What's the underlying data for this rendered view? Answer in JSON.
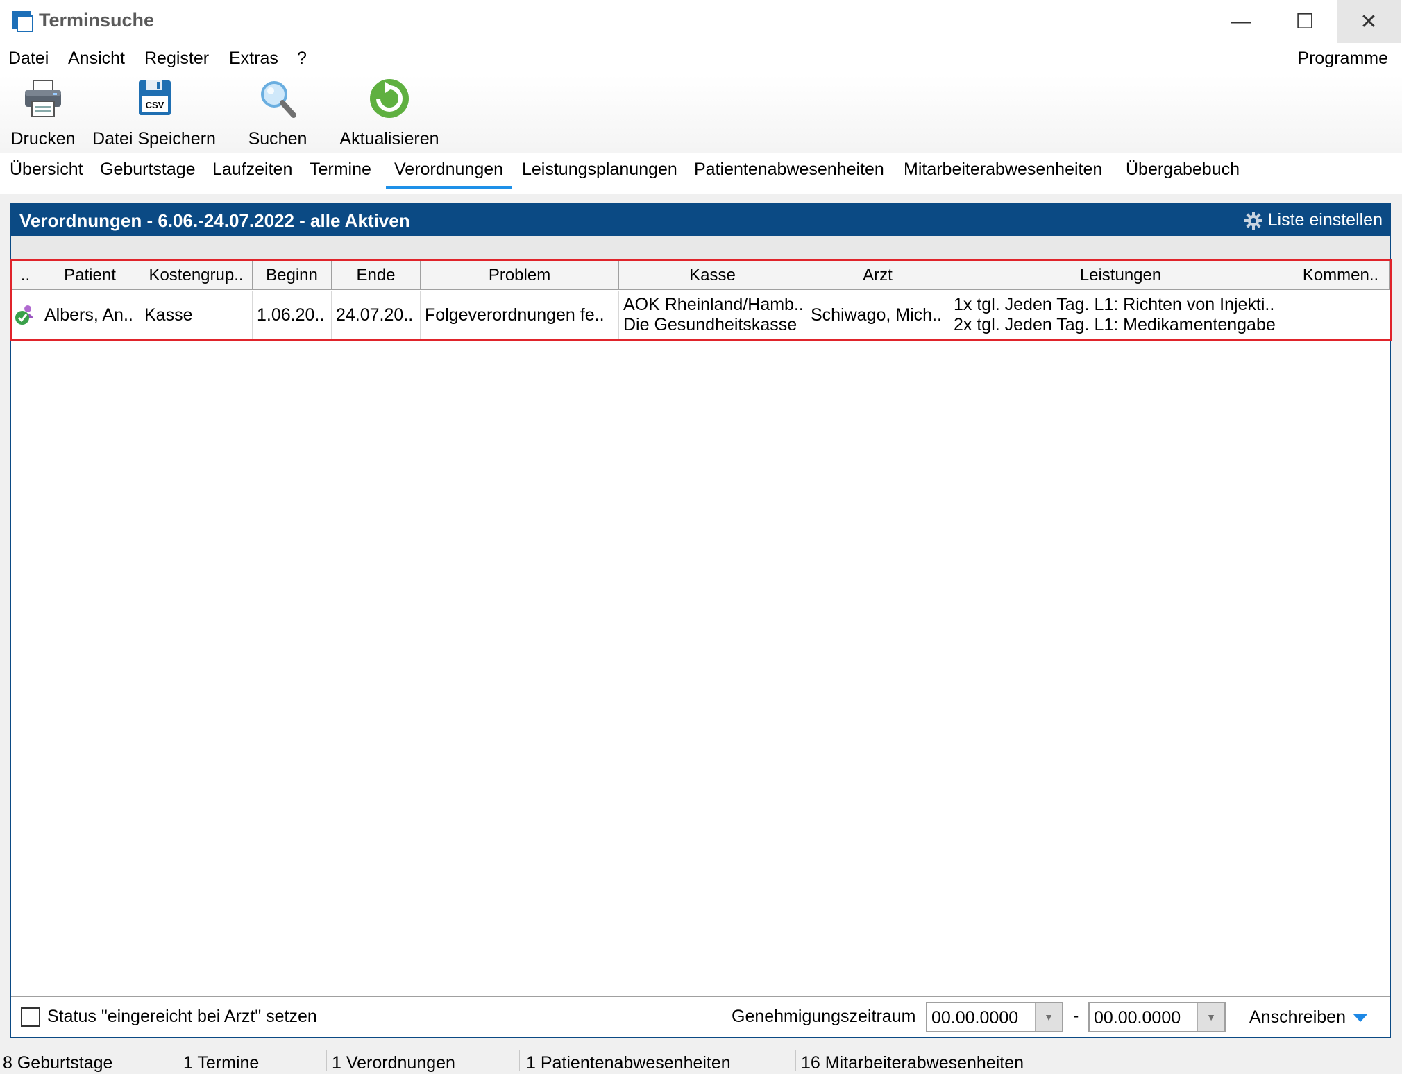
{
  "window": {
    "title": "Terminsuche",
    "minimize": "—",
    "maximize": "☐",
    "close": "✕"
  },
  "menu": {
    "items": [
      "Datei",
      "Ansicht",
      "Register",
      "Extras",
      "?"
    ],
    "programme": "Programme"
  },
  "toolbar": {
    "print": "Drucken",
    "save_file": "Datei Speichern",
    "search": "Suchen",
    "refresh": "Aktualisieren",
    "csv_badge": "CSV"
  },
  "tabs": [
    "Übersicht",
    "Geburtstage",
    "Laufzeiten",
    "Termine",
    "Verordnungen",
    "Leistungsplanungen",
    "Patientenabwesenheiten",
    "Mitarbeiterabwesenheiten",
    "Übergabebuch"
  ],
  "active_tab": "Verordnungen",
  "panel": {
    "title": "Verordnungen - 6.06.-24.07.2022 - alle Aktiven",
    "configure": "Liste einstellen"
  },
  "table": {
    "headers": [
      "..",
      "Patient",
      "Kostengrup..",
      "Beginn",
      "Ende",
      "Problem",
      "Kasse",
      "Arzt",
      "Leistungen",
      "Kommen.."
    ],
    "rows": [
      {
        "status_icon": "patient-approved-icon",
        "patient": "Albers, An..",
        "kostengruppe": "Kasse",
        "beginn": "1.06.20..",
        "ende": "24.07.20..",
        "problem": "Folgeverordnungen fe..",
        "kasse_line1": "AOK Rheinland/Hamb..",
        "kasse_line2": "Die Gesundheitskasse",
        "arzt": "Schiwago, Mich..",
        "leistungen_line1": "1x tgl. Jeden Tag. L1: Richten von Injekti..",
        "leistungen_line2": "2x tgl. Jeden Tag. L1: Medikamentengabe",
        "kommentar": ""
      }
    ]
  },
  "footer": {
    "checkbox_label": "Status \"eingereicht bei Arzt\" setzen",
    "period_label": "Genehmigungszeitraum",
    "date_from": "00.00.0000",
    "date_separator": "-",
    "date_to": "00.00.0000",
    "letter_button": "Anschreiben"
  },
  "statusbar": [
    "8 Geburtstage",
    "1 Termine",
    "1 Verordnungen",
    "1 Patientenabwesenheiten",
    "16 Mitarbeiterabwesenheiten"
  ],
  "colors": {
    "header_blue": "#0b4a84",
    "highlight_red": "#e0242b",
    "tab_underline": "#1e90e8"
  }
}
